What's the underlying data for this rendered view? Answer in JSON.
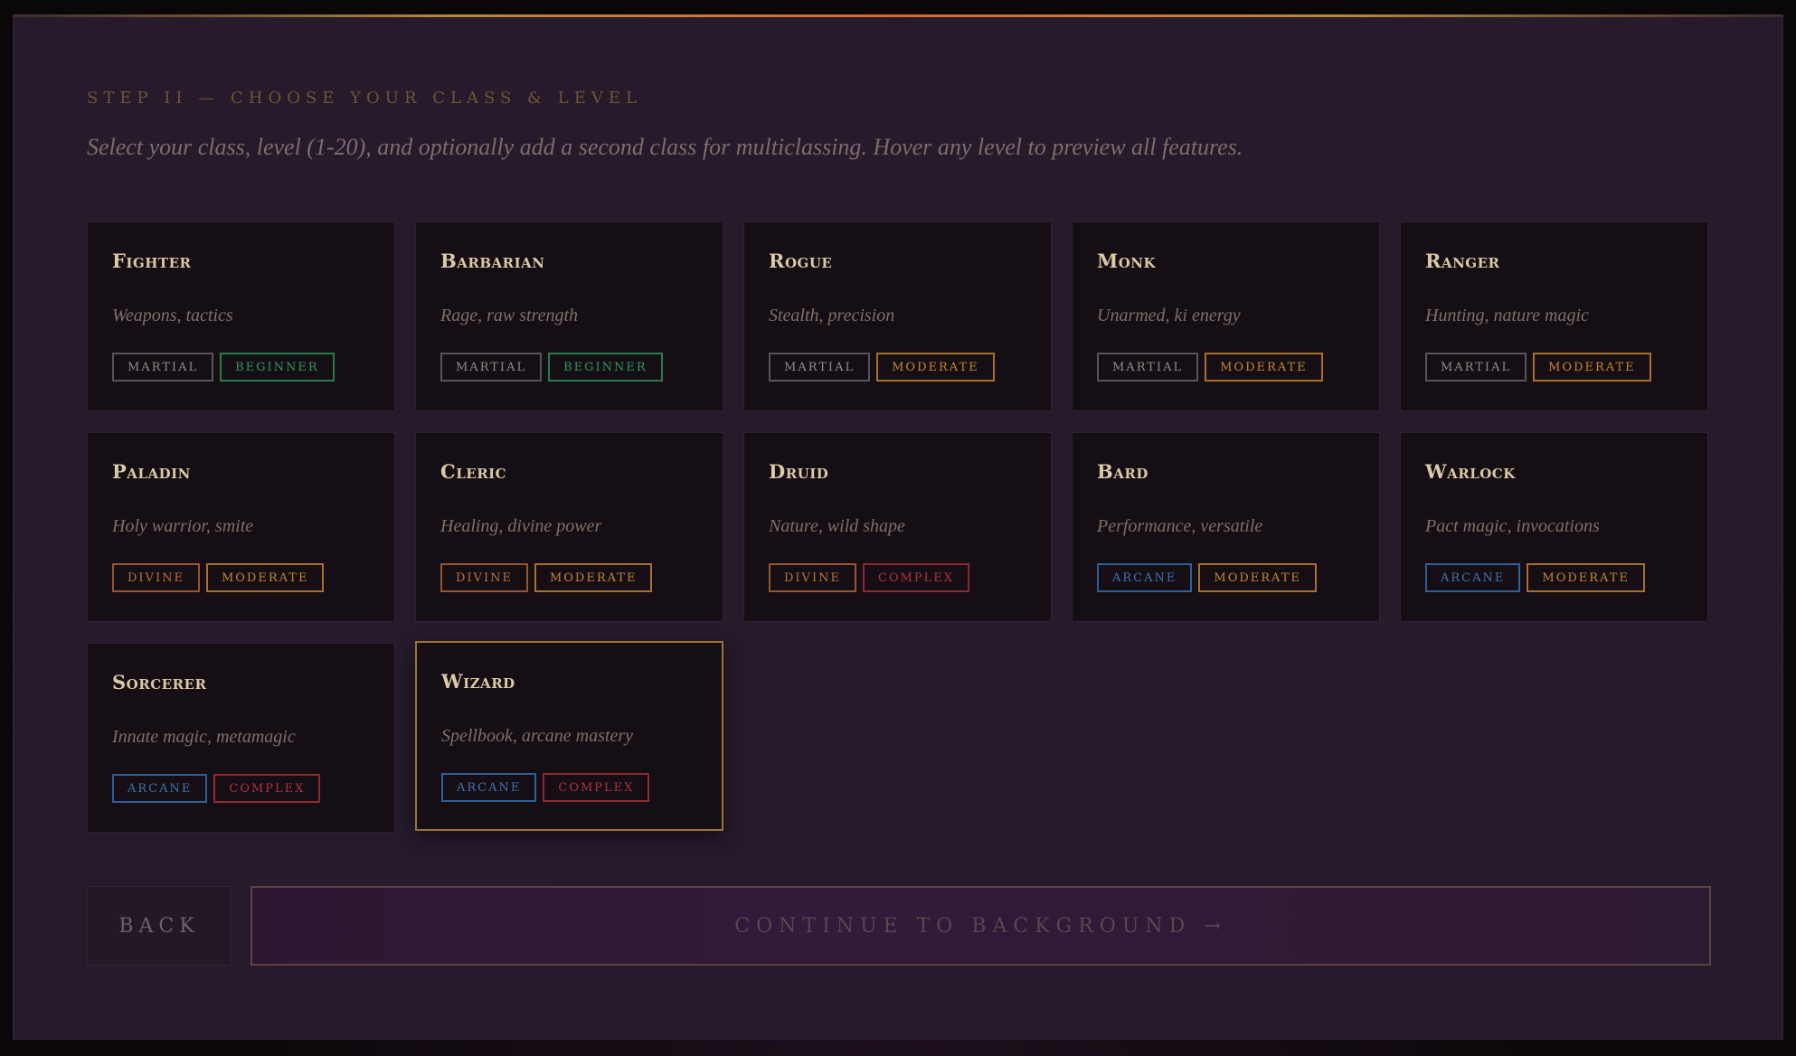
{
  "header": {
    "step": "STEP II — CHOOSE YOUR CLASS & LEVEL",
    "subtitle": "Select your class, level (1-20), and optionally add a second class for multiclassing. Hover any level to preview all features."
  },
  "classes": [
    {
      "name": "Fighter",
      "desc": "Weapons, tactics",
      "tags": [
        {
          "label": "MARTIAL",
          "kind": "martial"
        },
        {
          "label": "BEGINNER",
          "kind": "beginner"
        }
      ]
    },
    {
      "name": "Barbarian",
      "desc": "Rage, raw strength",
      "tags": [
        {
          "label": "MARTIAL",
          "kind": "martial"
        },
        {
          "label": "BEGINNER",
          "kind": "beginner"
        }
      ]
    },
    {
      "name": "Rogue",
      "desc": "Stealth, precision",
      "tags": [
        {
          "label": "MARTIAL",
          "kind": "martial"
        },
        {
          "label": "MODERATE",
          "kind": "moderate"
        }
      ]
    },
    {
      "name": "Monk",
      "desc": "Unarmed, ki energy",
      "tags": [
        {
          "label": "MARTIAL",
          "kind": "martial"
        },
        {
          "label": "MODERATE",
          "kind": "moderate"
        }
      ]
    },
    {
      "name": "Ranger",
      "desc": "Hunting, nature magic",
      "tags": [
        {
          "label": "MARTIAL",
          "kind": "martial"
        },
        {
          "label": "MODERATE",
          "kind": "moderate"
        }
      ]
    },
    {
      "name": "Paladin",
      "desc": "Holy warrior, smite",
      "tags": [
        {
          "label": "DIVINE",
          "kind": "divine"
        },
        {
          "label": "MODERATE",
          "kind": "moderate"
        }
      ]
    },
    {
      "name": "Cleric",
      "desc": "Healing, divine power",
      "tags": [
        {
          "label": "DIVINE",
          "kind": "divine"
        },
        {
          "label": "MODERATE",
          "kind": "moderate"
        }
      ]
    },
    {
      "name": "Druid",
      "desc": "Nature, wild shape",
      "tags": [
        {
          "label": "DIVINE",
          "kind": "divine"
        },
        {
          "label": "COMPLEX",
          "kind": "complex"
        }
      ]
    },
    {
      "name": "Bard",
      "desc": "Performance, versatile",
      "tags": [
        {
          "label": "ARCANE",
          "kind": "arcane"
        },
        {
          "label": "MODERATE",
          "kind": "moderate"
        }
      ]
    },
    {
      "name": "Warlock",
      "desc": "Pact magic, invocations",
      "tags": [
        {
          "label": "ARCANE",
          "kind": "arcane"
        },
        {
          "label": "MODERATE",
          "kind": "moderate"
        }
      ]
    },
    {
      "name": "Sorcerer",
      "desc": "Innate magic, metamagic",
      "tags": [
        {
          "label": "ARCANE",
          "kind": "arcane"
        },
        {
          "label": "COMPLEX",
          "kind": "complex"
        }
      ]
    },
    {
      "name": "Wizard",
      "desc": "Spellbook, arcane mastery",
      "tags": [
        {
          "label": "ARCANE",
          "kind": "arcane"
        },
        {
          "label": "COMPLEX",
          "kind": "complex"
        }
      ],
      "selected": true
    }
  ],
  "footer": {
    "back_label": "BACK",
    "continue_label": "CONTINUE TO BACKGROUND →"
  },
  "colors": {
    "accent_gold": "#9a7536",
    "martial": "#8f8a89",
    "beginner": "#2e9a5a",
    "moderate": "#c7862a",
    "divine": "#b9743a",
    "complex": "#b0333d",
    "arcane": "#3f74b0"
  }
}
